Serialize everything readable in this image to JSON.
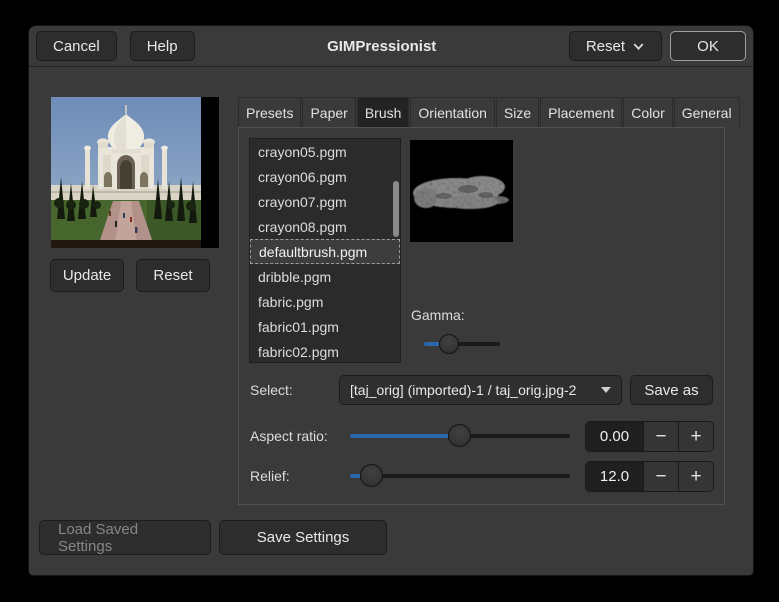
{
  "titlebar": {
    "title": "GIMPressionist",
    "cancel_label": "Cancel",
    "help_label": "Help",
    "reset_label": "Reset",
    "ok_label": "OK"
  },
  "preview_panel": {
    "update_label": "Update",
    "reset_label": "Reset"
  },
  "tabs": {
    "items": [
      "Presets",
      "Paper",
      "Brush",
      "Orientation",
      "Size",
      "Placement",
      "Color",
      "General"
    ],
    "active": "Brush"
  },
  "brush_tab": {
    "brush_list": [
      "crayon05.pgm",
      "crayon06.pgm",
      "crayon07.pgm",
      "crayon08.pgm",
      "defaultbrush.pgm",
      "dribble.pgm",
      "fabric.pgm",
      "fabric01.pgm",
      "fabric02.pgm"
    ],
    "selected_brush": "defaultbrush.pgm",
    "gamma_label": "Gamma:",
    "gamma_slider_percent": 33,
    "select_label": "Select:",
    "select_value": "[taj_orig] (imported)-1 / taj_orig.jpg-2",
    "save_as_label": "Save as",
    "aspect_ratio_label": "Aspect ratio:",
    "aspect_ratio_value": "0.00",
    "aspect_ratio_slider_percent": 50,
    "relief_label": "Relief:",
    "relief_value": "12.0",
    "relief_slider_percent": 10
  },
  "footer": {
    "load_saved_label": "Load Saved Settings",
    "load_saved_enabled": false,
    "save_settings_label": "Save Settings"
  },
  "icons": {
    "minus": "−",
    "plus": "+"
  },
  "colors": {
    "accent_blue": "#2b66ad",
    "window_bg": "#3a3a3a",
    "list_bg": "#2b2b2b",
    "active_tab_bg": "#232323"
  }
}
